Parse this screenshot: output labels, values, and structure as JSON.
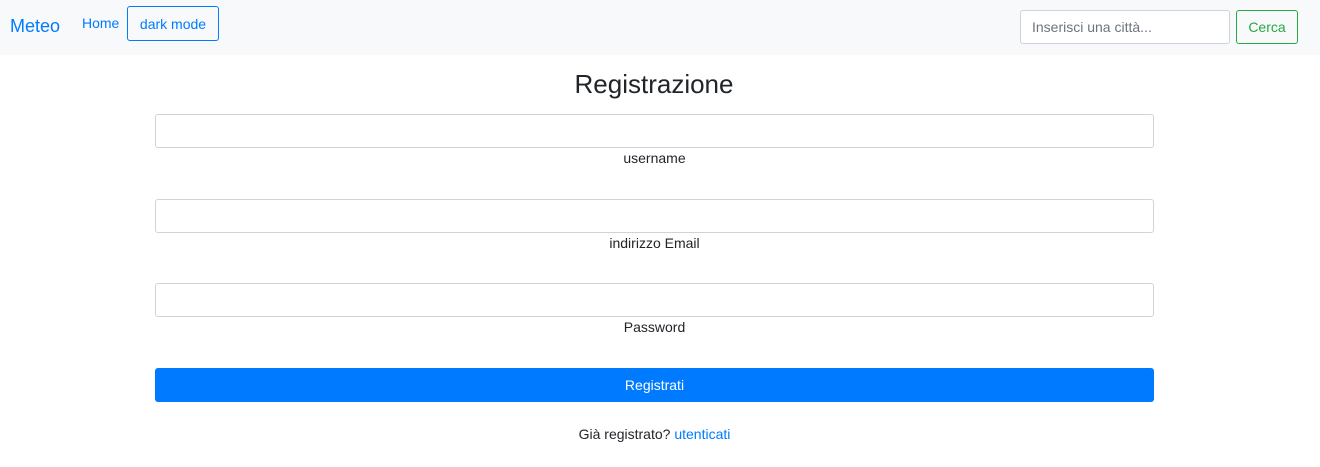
{
  "navbar": {
    "brand": "Meteo",
    "home_label": "Home",
    "dark_mode_label": "dark mode",
    "search": {
      "placeholder": "Inserisci una città...",
      "value": "",
      "button_label": "Cerca"
    }
  },
  "form": {
    "title": "Registrazione",
    "fields": [
      {
        "label": "username",
        "value": ""
      },
      {
        "label": "indirizzo Email",
        "value": ""
      },
      {
        "label": "Password",
        "value": ""
      }
    ],
    "submit_label": "Registrati",
    "login_prompt": "Già registrato?",
    "login_link": "utenticati"
  },
  "colors": {
    "primary": "#007bff",
    "success": "#28a745",
    "navbar_bg": "#f8f9fa"
  }
}
